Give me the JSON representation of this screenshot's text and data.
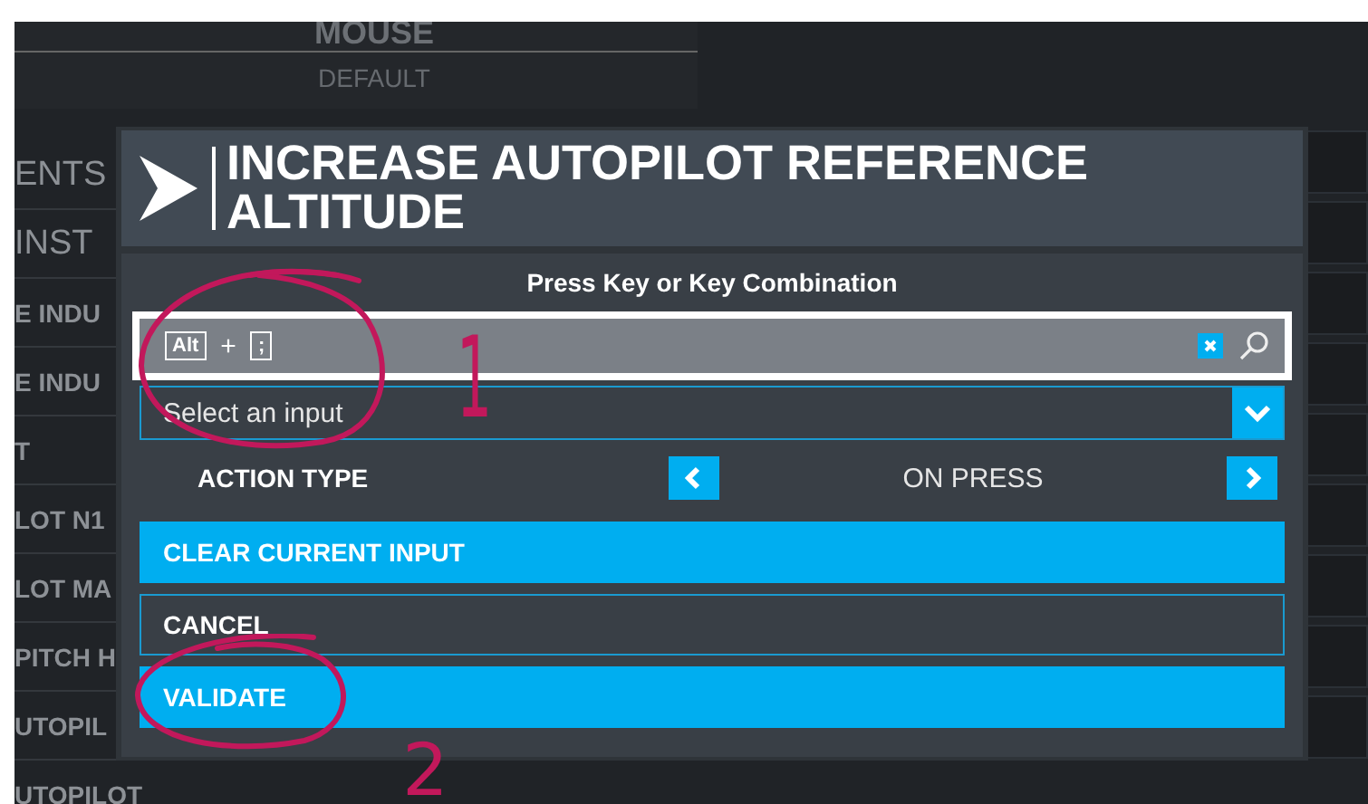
{
  "background": {
    "header": {
      "title": "MOUSE",
      "subtitle": "DEFAULT"
    },
    "list_items": [
      "ENTS",
      "INST",
      "E INDU",
      "E INDU",
      "T",
      "LOT N1",
      "LOT MA",
      "PITCH H",
      "UTOPIL",
      "UTOPILOT"
    ]
  },
  "dialog": {
    "title": "INCREASE AUTOPILOT REFERENCE ALTITUDE",
    "prompt": "Press Key or Key Combination",
    "key_combo": {
      "keys": [
        "Alt",
        ";"
      ],
      "separator": "+"
    },
    "input_select": {
      "text": "Select an input"
    },
    "action_type": {
      "label": "ACTION TYPE",
      "value": "ON PRESS"
    },
    "buttons": [
      {
        "label": "CLEAR CURRENT INPUT",
        "kind": "filled"
      },
      {
        "label": "CANCEL",
        "kind": "outline"
      },
      {
        "label": "VALIDATE",
        "kind": "filled"
      }
    ]
  },
  "annotations": [
    {
      "label": "1"
    },
    {
      "label": "2"
    }
  ]
}
